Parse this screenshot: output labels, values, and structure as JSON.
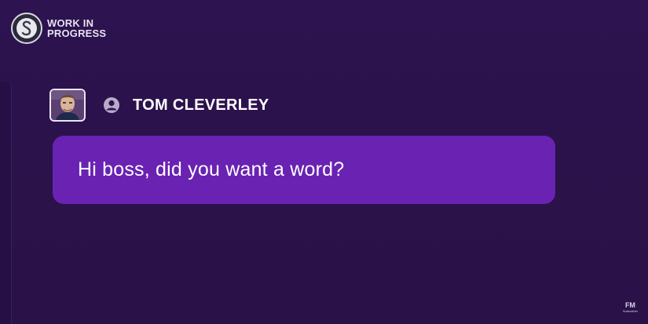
{
  "colors": {
    "background": "#2c1450",
    "bubble": "#6a22b3",
    "text": "#ffffff"
  },
  "branding": {
    "logo_line1": "WORK IN",
    "logo_line2": "PROGRESS",
    "badge_icon": "club-crest-icon"
  },
  "speaker": {
    "name": "TOM CLEVERLEY",
    "avatar_icon": "player-portrait",
    "person_icon": "person-icon"
  },
  "message": {
    "text": "Hi boss, did you want a word?"
  },
  "watermark": {
    "main": "FM",
    "sub": "Subscriber"
  }
}
